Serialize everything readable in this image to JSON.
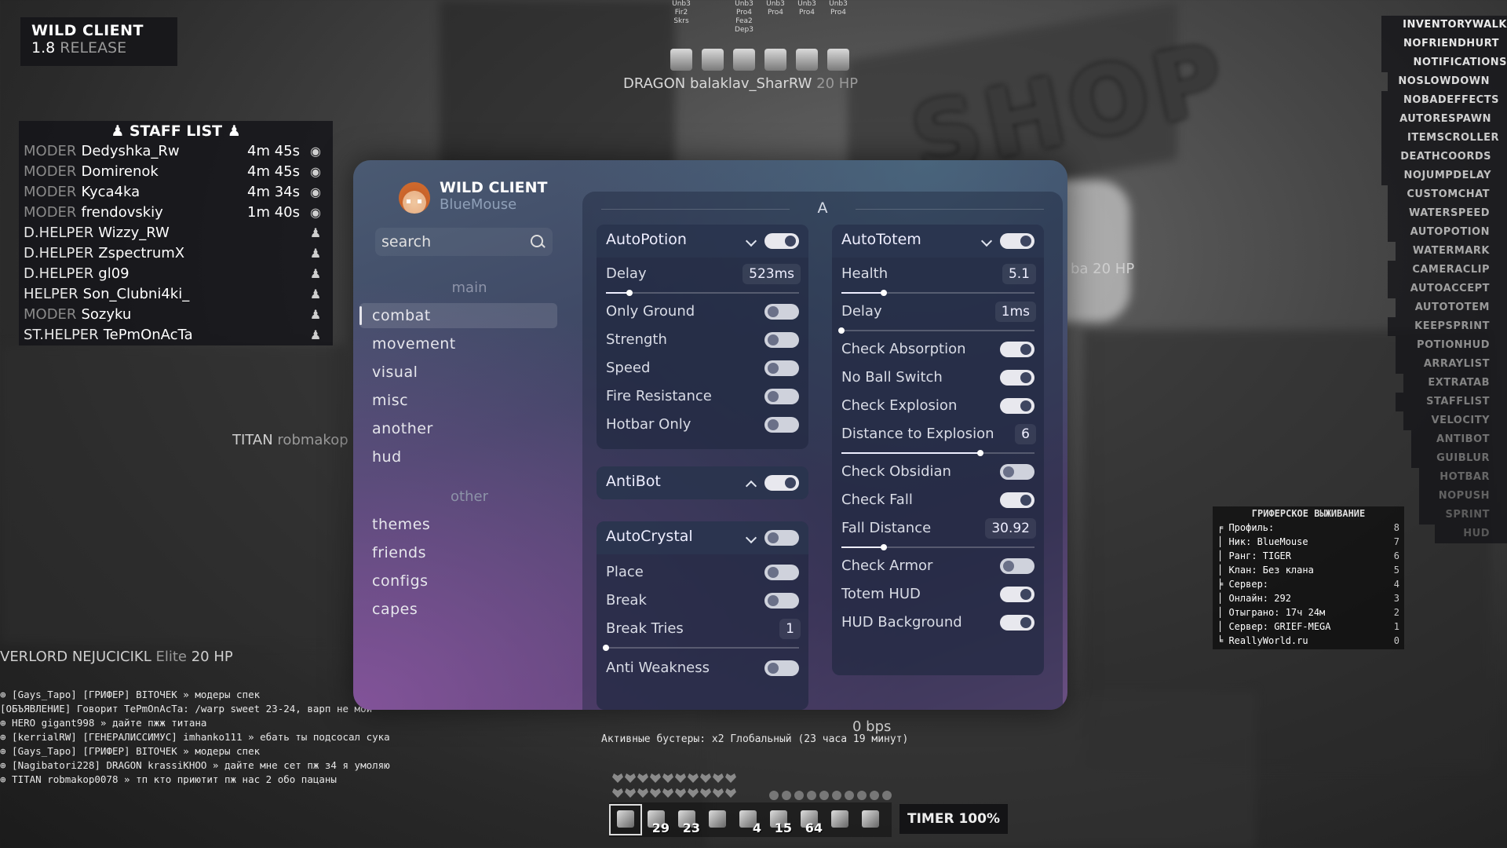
{
  "logo": {
    "title": "WILD CLIENT",
    "version": "1.8",
    "release": "RELEASE"
  },
  "staff": {
    "title": "STAFF LIST",
    "rows": [
      {
        "rank": "MODER",
        "name": "Dedyshka_Rw",
        "time": "4m 45s",
        "icon": "eye-icon"
      },
      {
        "rank": "MODER",
        "name": "Domirenok",
        "time": "4m 45s",
        "icon": "eye-icon"
      },
      {
        "rank": "MODER",
        "name": "Kyca4ka",
        "time": "4m 34s",
        "icon": "eye-icon"
      },
      {
        "rank": "MODER",
        "name": "frendovskiy",
        "time": "1m 40s",
        "icon": "eye-icon"
      },
      {
        "rank": "D.HELPER",
        "name": "Wizzy_RW",
        "time": "",
        "icon": "person-icon"
      },
      {
        "rank": "D.HELPER",
        "name": "ZspectrumX",
        "time": "",
        "icon": "person-icon"
      },
      {
        "rank": "D.HELPER",
        "name": "gl09",
        "time": "",
        "icon": "person-icon"
      },
      {
        "rank": "HELPER",
        "name": "Son_Clubni4ki_",
        "time": "",
        "icon": "person-icon"
      },
      {
        "rank": "MODER",
        "name": "Sozyku",
        "time": "",
        "icon": "person-icon"
      },
      {
        "rank": "ST.HELPER",
        "name": "TePmOnAcTa",
        "time": "",
        "icon": "person-icon"
      }
    ]
  },
  "equipment": {
    "items": [
      {
        "label": "Unb3\nFir2\nSkrs",
        "icon": "sword-icon"
      },
      {
        "label": "",
        "icon": "totem-icon"
      },
      {
        "label": "Unb3\nPro4\nFea2\nDep3",
        "icon": "boots-icon"
      },
      {
        "label": "Unb3\nPro4",
        "icon": "leggings-icon"
      },
      {
        "label": "Unb3\nPro4",
        "icon": "chestplate-icon"
      },
      {
        "label": "Unb3\nPro4",
        "icon": "helmet-icon"
      }
    ],
    "nametag_rank": "DRAGON",
    "nametag_name": "balaklav_SharRW",
    "nametag_hp": "20 HP"
  },
  "world_tags": {
    "titan_rank": "TITAN",
    "titan_name": "robmakop",
    "overlord": "VERLORD NEJUCICIKL",
    "overlord_dim": "Elite",
    "overlord_hp": "20 HP",
    "right_tag": "ba 20 HP"
  },
  "arraylist": [
    "INVENTORYWALK",
    "NOFRIENDHURT",
    "NOTIFICATIONS",
    "NOSLOWDOWN",
    "NOBADEFFECTS",
    "AUTORESPAWN",
    "ITEMSCROLLER",
    "DEATHCOORDS",
    "NOJUMPDELAY",
    "CUSTOMCHAT",
    "WATERSPEED",
    "AUTOPOTION",
    "WATERMARK",
    "CAMERACLIP",
    "AUTOACCEPT",
    "AUTOTOTEM",
    "KEEPSPRINT",
    "POTIONHUD",
    "ARRAYLIST",
    "EXTRATAB",
    "STAFFLIST",
    "VELOCITY",
    "ANTIBOT",
    "GUIBLUR",
    "HOTBAR",
    "NOPUSH",
    "SPRINT",
    "HUD"
  ],
  "scoreboard": {
    "title": "ГРИФЕРСКОЕ ВЫЖИВАНИЕ",
    "rows": [
      {
        "text": "╒ Профиль:",
        "num": "8"
      },
      {
        "text": "│ Ник: BlueMouse",
        "num": "7"
      },
      {
        "text": "│ Ранг: TIGER",
        "num": "6"
      },
      {
        "text": "│ Клан: Без клана",
        "num": "5"
      },
      {
        "text": "╞ Сервер:",
        "num": "4"
      },
      {
        "text": "│ Онлайн: 292",
        "num": "3"
      },
      {
        "text": "│ Отыграно: 17ч 24м",
        "num": "2"
      },
      {
        "text": "│ Сервер: GRIEF-MEGA",
        "num": "1"
      },
      {
        "text": "╘ ReallyWorld.ru",
        "num": "0"
      }
    ]
  },
  "chat": [
    "⊕ [Gays_Tapo] [ГРИФЕР] ВIТОЧЕК » модеры спек",
    "[ОБЪЯВЛЕНИЕ] Говорит TePmOnAcTa: /warp sweet 23-24, варп не мой",
    "⊕ HERO gigant998 » дайте пжж титана",
    "⊕ [kerrialRW] [ГЕНЕРАЛИССИМУС] imhanko111 » ебать ты подсосал сука",
    "⊕ [Gays_Tapo] [ГРИФЕР] ВIТОЧЕК » модеры спек",
    "⊕ [Nagibatori228] DRAGON krassiKHOO » дайте мне сет пж з4 я умоляю",
    "⊕ TITAN robmakop0078 » тп кто приютит пж нас 2 обо пацаны"
  ],
  "boosters": "Активные бустеры: x2 Глобальный (23 часа 19 минут)",
  "bps": "0 bps",
  "hotbar": {
    "slots": [
      {
        "icon": "sword-icon",
        "count": ""
      },
      {
        "icon": "pearl-icon",
        "count": "29"
      },
      {
        "icon": "pickaxe-icon",
        "count": "23"
      },
      {
        "icon": "axe-icon",
        "count": ""
      },
      {
        "icon": "cobweb-icon",
        "count": "4"
      },
      {
        "icon": "egg-icon",
        "count": "15"
      },
      {
        "icon": "potion-icon",
        "count": "64"
      },
      {
        "icon": "bucket-icon",
        "count": ""
      },
      {
        "icon": "flask-icon",
        "count": ""
      }
    ],
    "timer": "TIMER 100%",
    "hearts": 20,
    "hunger": 10
  },
  "gui": {
    "title": "WILD CLIENT",
    "username": "BlueMouse",
    "search_placeholder": "search",
    "main_heading": "main",
    "main_items": [
      "combat",
      "movement",
      "visual",
      "misc",
      "another",
      "hud"
    ],
    "active_category": "combat",
    "other_heading": "other",
    "other_items": [
      "themes",
      "friends",
      "configs",
      "capes"
    ],
    "section_title": "A",
    "autopotion": {
      "name": "AutoPotion",
      "enabled": true,
      "delay_label": "Delay",
      "delay_value": "523ms",
      "delay_fraction": 0.12,
      "only_ground": "Only Ground",
      "strength": "Strength",
      "speed": "Speed",
      "fire_resistance": "Fire Resistance",
      "hotbar_only": "Hotbar Only"
    },
    "antibot": {
      "name": "AntiBot",
      "enabled": true
    },
    "autocrystal": {
      "name": "AutoCrystal",
      "enabled": false,
      "place": "Place",
      "break": "Break",
      "break_tries_label": "Break Tries",
      "break_tries_value": "1",
      "break_tries_fraction": 0.0,
      "anti_weakness": "Anti Weakness"
    },
    "autototem": {
      "name": "AutoTotem",
      "enabled": true,
      "health_label": "Health",
      "health_value": "5.1",
      "health_fraction": 0.22,
      "delay_label": "Delay",
      "delay_value": "1ms",
      "delay_fraction": 0.0,
      "check_absorption": "Check Absorption",
      "no_ball_switch": "No Ball Switch",
      "check_explosion": "Check Explosion",
      "distance_label": "Distance to Explosion",
      "distance_value": "6",
      "distance_fraction": 0.72,
      "check_obsidian": "Check Obsidian",
      "check_fall": "Check Fall",
      "fall_label": "Fall Distance",
      "fall_value": "30.92",
      "fall_fraction": 0.22,
      "check_armor": "Check Armor",
      "totem_hud": "Totem HUD",
      "hud_background": "HUD Background"
    }
  }
}
